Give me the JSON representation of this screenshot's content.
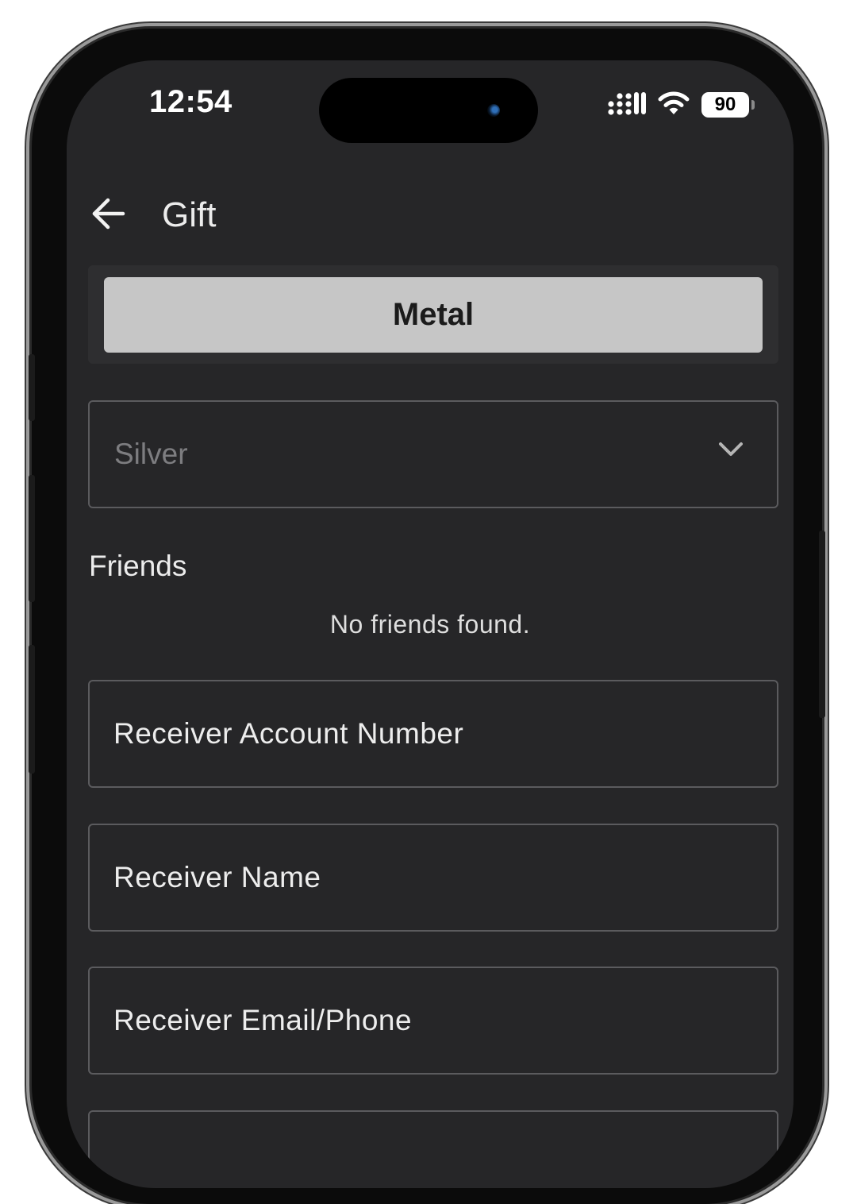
{
  "status_bar": {
    "time": "12:54",
    "battery": "90",
    "icons": [
      "signal-icon",
      "wifi-icon",
      "battery-icon"
    ]
  },
  "header": {
    "back_icon": "arrow-left-icon",
    "title": "Gift"
  },
  "tabs": {
    "selected_label": "Metal"
  },
  "metal_select": {
    "value": "Silver",
    "icon": "chevron-down-icon"
  },
  "friends": {
    "label": "Friends",
    "empty_message": "No friends found."
  },
  "form": {
    "account_number_label": "Receiver Account Number",
    "name_label": "Receiver Name",
    "contact_label": "Receiver Email/Phone"
  },
  "colors": {
    "screen_bg": "#262628",
    "segment_active": "#c6c6c6",
    "field_border": "#5b5b5e"
  }
}
